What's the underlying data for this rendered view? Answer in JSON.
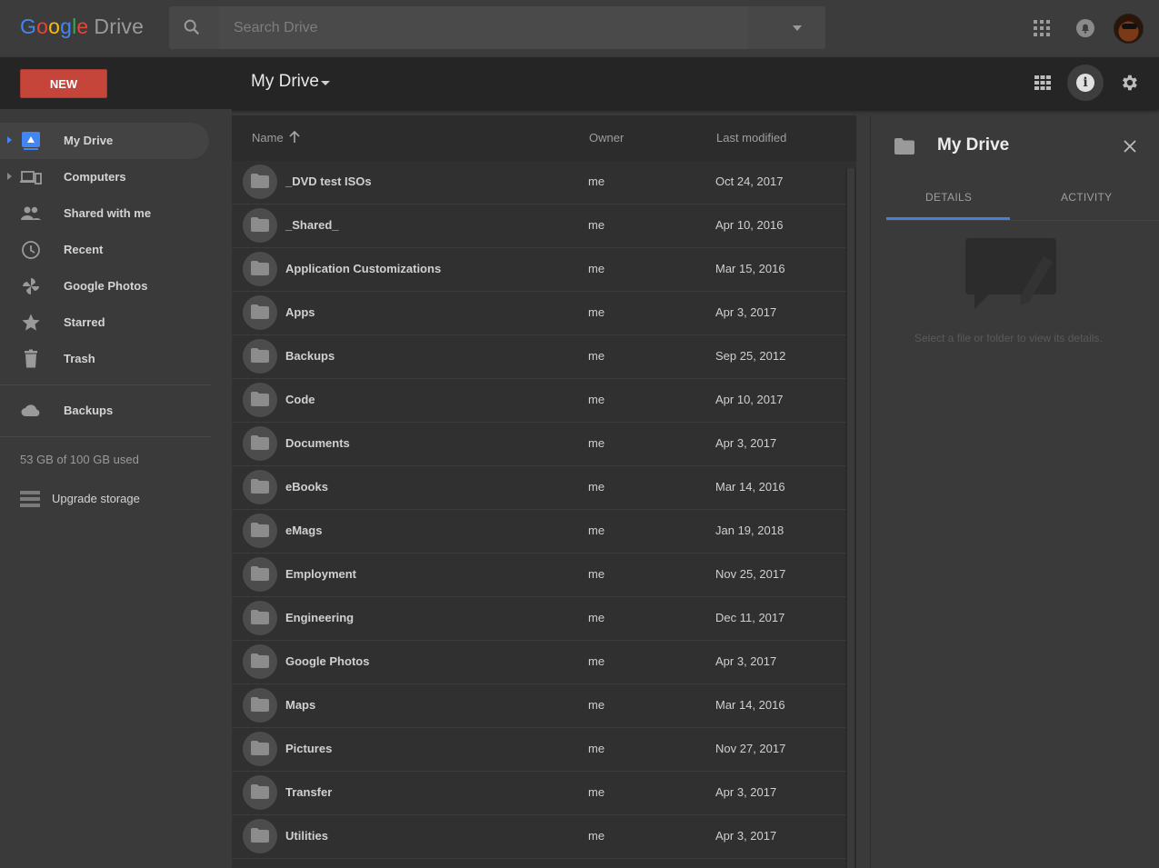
{
  "app": {
    "logo_google": [
      "G",
      "o",
      "o",
      "g",
      "l",
      "e"
    ],
    "logo_product": "Drive"
  },
  "search": {
    "placeholder": "Search Drive"
  },
  "toolbar": {
    "new_label": "NEW",
    "breadcrumb": "My Drive"
  },
  "sidebar": {
    "items": [
      {
        "label": "My Drive",
        "icon": "my-drive-icon",
        "active": true
      },
      {
        "label": "Computers",
        "icon": "computers-icon"
      },
      {
        "label": "Shared with me",
        "icon": "people-icon"
      },
      {
        "label": "Recent",
        "icon": "clock-icon"
      },
      {
        "label": "Google Photos",
        "icon": "photos-pinwheel-icon"
      },
      {
        "label": "Starred",
        "icon": "star-icon"
      },
      {
        "label": "Trash",
        "icon": "trash-icon"
      },
      {
        "label": "Backups",
        "icon": "cloud-icon"
      }
    ],
    "storage_text": "53 GB of 100 GB used",
    "upgrade_label": "Upgrade storage"
  },
  "filelist": {
    "columns": {
      "name": "Name",
      "owner": "Owner",
      "modified": "Last modified"
    },
    "rows": [
      {
        "name": "_DVD test ISOs",
        "owner": "me",
        "modified": "Oct 24, 2017"
      },
      {
        "name": "_Shared_",
        "owner": "me",
        "modified": "Apr 10, 2016"
      },
      {
        "name": "Application Customizations",
        "owner": "me",
        "modified": "Mar 15, 2016"
      },
      {
        "name": "Apps",
        "owner": "me",
        "modified": "Apr 3, 2017"
      },
      {
        "name": "Backups",
        "owner": "me",
        "modified": "Sep 25, 2012"
      },
      {
        "name": "Code",
        "owner": "me",
        "modified": "Apr 10, 2017"
      },
      {
        "name": "Documents",
        "owner": "me",
        "modified": "Apr 3, 2017"
      },
      {
        "name": "eBooks",
        "owner": "me",
        "modified": "Mar 14, 2016"
      },
      {
        "name": "eMags",
        "owner": "me",
        "modified": "Jan 19, 2018"
      },
      {
        "name": "Employment",
        "owner": "me",
        "modified": "Nov 25, 2017"
      },
      {
        "name": "Engineering",
        "owner": "me",
        "modified": "Dec 11, 2017"
      },
      {
        "name": "Google Photos",
        "owner": "me",
        "modified": "Apr 3, 2017"
      },
      {
        "name": "Maps",
        "owner": "me",
        "modified": "Mar 14, 2016"
      },
      {
        "name": "Pictures",
        "owner": "me",
        "modified": "Nov 27, 2017"
      },
      {
        "name": "Transfer",
        "owner": "me",
        "modified": "Apr 3, 2017"
      },
      {
        "name": "Utilities",
        "owner": "me",
        "modified": "Apr 3, 2017"
      }
    ]
  },
  "details": {
    "title": "My Drive",
    "tabs": [
      "DETAILS",
      "ACTIVITY"
    ],
    "empty_message": "Select a file or folder to view its details."
  },
  "colors": {
    "new_button": "#c5453a",
    "active_tab_underline": "#4a7fd8",
    "my_drive_icon": "#4285f4"
  }
}
